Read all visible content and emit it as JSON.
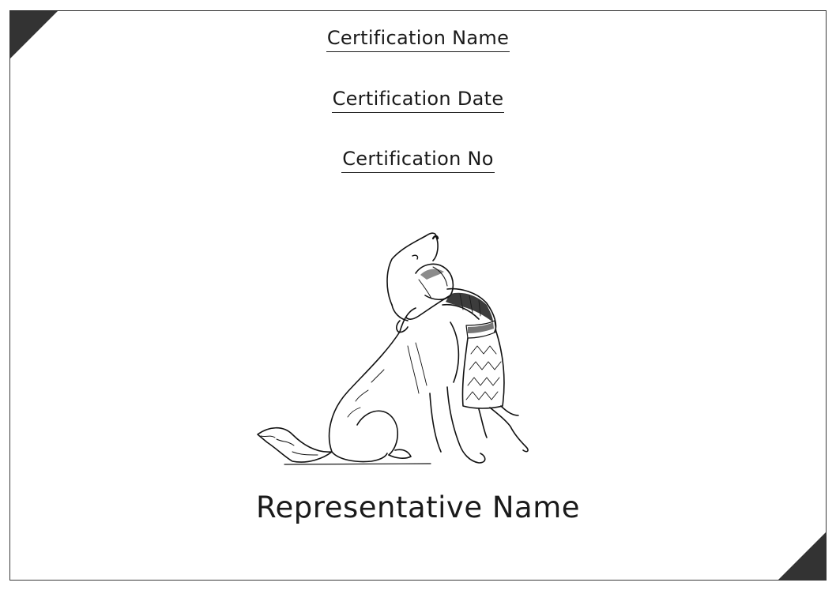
{
  "certificate": {
    "certification_name": "Certification Name",
    "certification_date": "Certification Date",
    "certification_no": "Certification No",
    "representative_name": "Representative Name"
  },
  "illustration": {
    "icon": "girl-hugging-dog-illustration"
  }
}
